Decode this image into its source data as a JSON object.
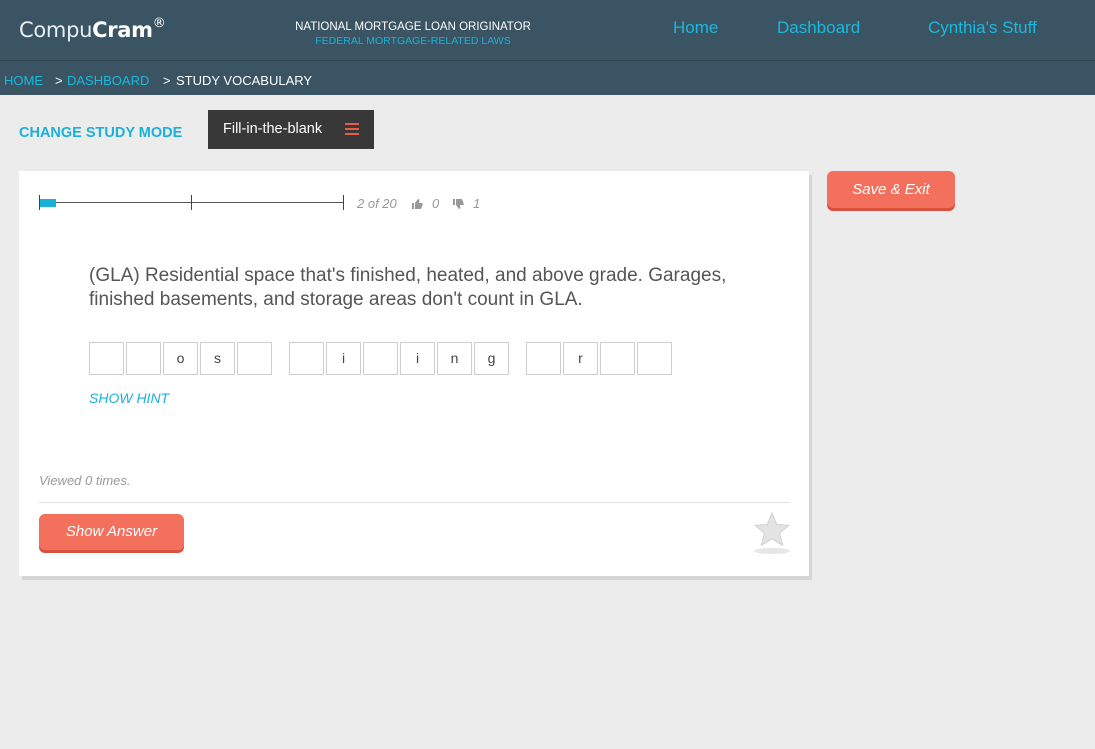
{
  "header": {
    "logo_light": "Compu",
    "logo_bold": "Cram",
    "logo_mark": "®",
    "course_title": "NATIONAL MORTGAGE LOAN ORIGINATOR",
    "course_subtitle": "FEDERAL MORTGAGE-RELATED LAWS",
    "nav": [
      "Home",
      "Dashboard",
      "Cynthia's Stuff"
    ]
  },
  "breadcrumb": {
    "home": "HOME",
    "dashboard": "DASHBOARD",
    "current": "STUDY VOCABULARY",
    "separator": ">"
  },
  "study_mode": {
    "label": "CHANGE STUDY MODE",
    "selected": "Fill-in-the-blank",
    "menu_icon": "hamburger-icon"
  },
  "progress": {
    "position": "2 of 20",
    "fraction_complete": 0.05,
    "thumbs_up_count": "0",
    "thumbs_down_count": "1"
  },
  "card": {
    "question": "(GLA) Residential space that's finished, heated, and above grade. Garages, finished basements, and storage areas don't count in GLA.",
    "words": [
      [
        "",
        "",
        "o",
        "s",
        ""
      ],
      [
        "",
        "i",
        "",
        "i",
        "n",
        "g"
      ],
      [
        "",
        "r",
        "",
        ""
      ]
    ],
    "hint_label": "SHOW HINT",
    "viewed_text": "Viewed 0 times.",
    "show_answer_label": "Show Answer",
    "favorite_icon": "star-icon"
  },
  "actions": {
    "save_exit_label": "Save & Exit"
  },
  "colors": {
    "header_bg": "#3b5463",
    "accent": "#1ab8dd",
    "button_red": "#f3705d",
    "page_bg": "#ececec"
  }
}
